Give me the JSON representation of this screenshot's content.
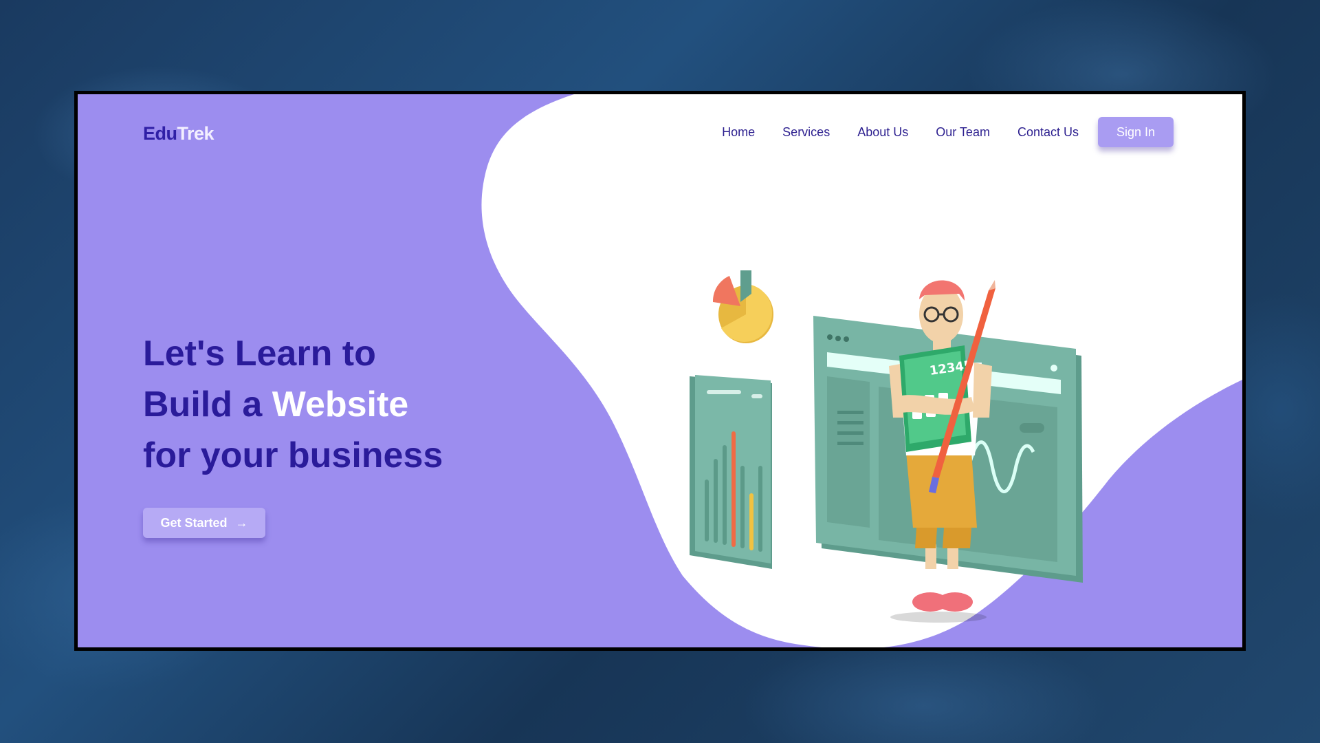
{
  "brand": {
    "part1": "Edu",
    "part2": "Trek"
  },
  "nav": {
    "items": [
      "Home",
      "Services",
      "About Us",
      "Our Team",
      "Contact Us"
    ],
    "signin_label": "Sign In"
  },
  "hero": {
    "line1": "Let's Learn to",
    "line2_prefix": "Build a ",
    "line2_highlight": "Website",
    "line3": "for your business",
    "cta_label": "Get Started",
    "cta_icon": "arrow-right-icon"
  },
  "illustration": {
    "calculator_text": "12345"
  },
  "colors": {
    "purple_bg": "#9c8def",
    "brand_dark": "#2a1b9a",
    "teal_panel": "#76b3a4",
    "white": "#ffffff"
  }
}
